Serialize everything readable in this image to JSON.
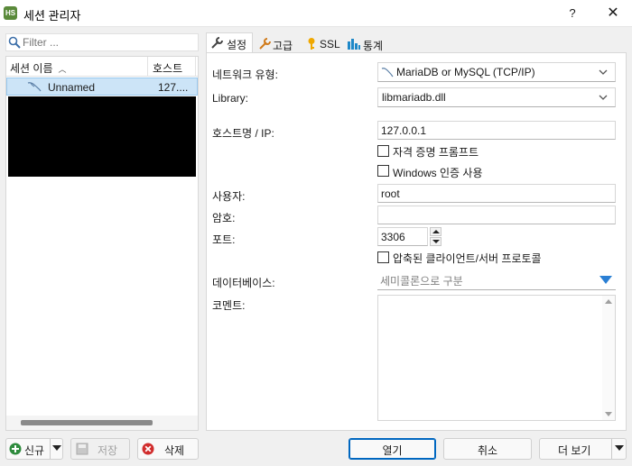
{
  "window": {
    "title": "세션 관리자",
    "app_icon_text": "HS",
    "help": "?",
    "close": "✕"
  },
  "left": {
    "filter_placeholder": "Filter ...",
    "columns": {
      "name": "세션 이름",
      "host": "호스트"
    },
    "sessions": [
      {
        "name": "Unnamed",
        "host": "127...."
      }
    ]
  },
  "bottom_left": {
    "new": "신규",
    "save": "저장",
    "delete": "삭제"
  },
  "tabs": [
    {
      "label": "설정",
      "icon": "wrench-icon",
      "active": true
    },
    {
      "label": "고급",
      "icon": "wrench-orange-icon"
    },
    {
      "label": "SSL",
      "icon": "key-icon"
    },
    {
      "label": "통계",
      "icon": "bar-chart-icon"
    }
  ],
  "settings": {
    "network_type_label": "네트워크 유형:",
    "network_type_value": "MariaDB or MySQL (TCP/IP)",
    "library_label": "Library:",
    "library_value": "libmariadb.dll",
    "host_label": "호스트명 / IP:",
    "host_value": "127.0.0.1",
    "credential_prompt": "자격 증명 프롬프트",
    "windows_auth": "Windows 인증 사용",
    "user_label": "사용자:",
    "user_value": "root",
    "password_label": "암호:",
    "password_value": "",
    "port_label": "포트:",
    "port_value": "3306",
    "compressed": "압축된 클라이언트/서버 프로토콜",
    "database_label": "데이터베이스:",
    "database_placeholder": "세미콜론으로 구분",
    "comment_label": "코멘트:"
  },
  "bottom_right": {
    "open": "열기",
    "cancel": "취소",
    "more": "더 보기"
  },
  "colors": {
    "selection": "#cce4f7",
    "accent": "#0067c0",
    "db_arrow": "#2a7fd4"
  }
}
